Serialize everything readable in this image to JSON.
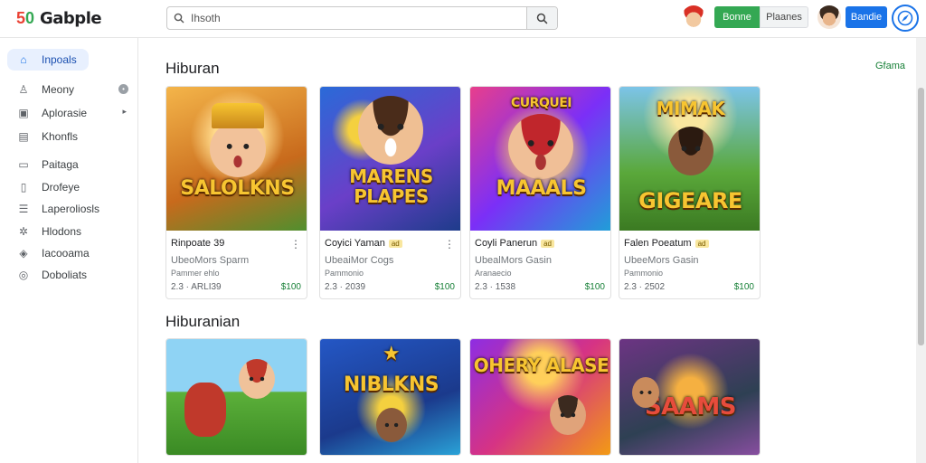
{
  "app": {
    "logo_mark_a": "5",
    "logo_mark_b": "0",
    "logo_text": "Gabple"
  },
  "search": {
    "value": "Ihsoth",
    "placeholder": "Ihsoth"
  },
  "header": {
    "green_button": "Bonne",
    "grey_button": "Plaanes",
    "blue_button": "Bandie"
  },
  "sidebar": {
    "items": [
      {
        "label": "Inpoals",
        "icon": "home-icon"
      },
      {
        "label": "Meony",
        "icon": "person-icon"
      },
      {
        "label": "Aplorasie",
        "icon": "box-icon"
      },
      {
        "label": "Khonfls",
        "icon": "book-icon"
      },
      {
        "label": "Paitaga",
        "icon": "card-icon"
      },
      {
        "label": "Drofeye",
        "icon": "doc-icon"
      },
      {
        "label": "Laperoliosls",
        "icon": "list-icon"
      },
      {
        "label": "Hlodons",
        "icon": "gear-icon"
      },
      {
        "label": "Iacooama",
        "icon": "tag-icon"
      },
      {
        "label": "Doboliats",
        "icon": "circle-icon"
      }
    ]
  },
  "sections": [
    {
      "title": "Hiburan",
      "see_all": "Gfama",
      "cards": [
        {
          "art_text": "SALOLKNS",
          "title": "Rinpoate 39",
          "tag": "",
          "subtitle": "UbeoMors Sparm",
          "developer": "Pammer ehlo",
          "stat": "2.3 · ARLI39",
          "price": "$100"
        },
        {
          "art_text": "MARENS PLAPES",
          "title": "Coyici Yaman",
          "tag": "ad",
          "subtitle": "UbeaiMor Cogs",
          "developer": "Pammonio",
          "stat": "2.3 · 2039",
          "price": "$100"
        },
        {
          "art_text": "MAAALS",
          "title": "Coyli Panerun",
          "tag": "ad",
          "subtitle": "UbealMors Gasin",
          "developer": "Aranaecio",
          "stat": "2.3 · 1538",
          "price": "$100"
        },
        {
          "art_text": "GIGEARE",
          "title": "Falen Poeatum",
          "tag": "ad",
          "subtitle": "UbeeMors Gasin",
          "developer": "Pammonio",
          "stat": "2.3 · 2502",
          "price": "$100"
        }
      ]
    },
    {
      "title": "Hiburanian",
      "cards": [
        {
          "art_text": ""
        },
        {
          "art_text": "NIBLKNS"
        },
        {
          "art_text": "OHERY ALASE"
        },
        {
          "art_text": "SAAMS"
        }
      ]
    }
  ],
  "colors": {
    "accent_green": "#34a853",
    "accent_blue": "#1a73e8",
    "price_green": "#188038"
  }
}
